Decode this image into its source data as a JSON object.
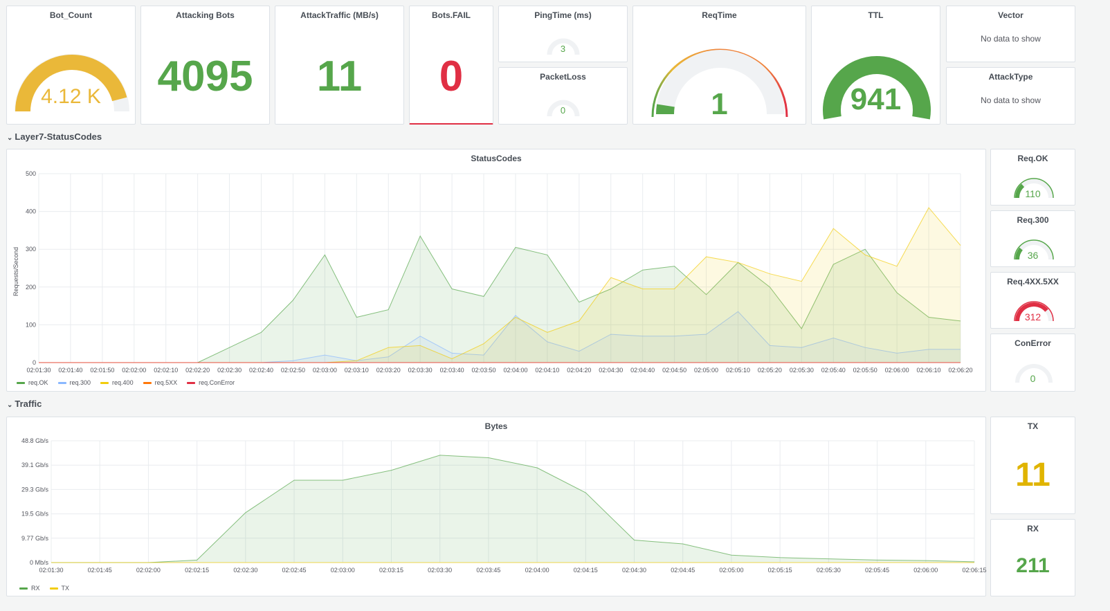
{
  "colors": {
    "green": "#56a64b",
    "yellow": "#f2cc0c",
    "red": "#e02f44",
    "orange": "#ff780a",
    "blue": "#8ab8ff",
    "gauge_bg": "#f0f2f4",
    "gold": "#e0b400"
  },
  "top": {
    "bot_count": {
      "title": "Bot_Count",
      "value": "4.12 K",
      "fraction": 0.92
    },
    "attacking_bots": {
      "title": "Attacking Bots",
      "value": "4095"
    },
    "attack_traffic": {
      "title": "AttackTraffic (MB/s)",
      "value": "11"
    },
    "bots_fail": {
      "title": "Bots.FAIL",
      "value": "0"
    },
    "ping_time": {
      "title": "PingTime (ms)",
      "value": "3"
    },
    "packet_loss": {
      "title": "PacketLoss",
      "value": "0"
    },
    "req_time": {
      "title": "ReqTime",
      "value": "1",
      "fraction": 0.05
    },
    "ttl": {
      "title": "TTL",
      "value": "941",
      "fraction": 1.0
    },
    "vector": {
      "title": "Vector",
      "empty": "No data to show"
    },
    "attack_type": {
      "title": "AttackType",
      "empty": "No data to show"
    }
  },
  "rows": {
    "layer7": "Layer7-StatusCodes",
    "traffic": "Traffic"
  },
  "side": {
    "req_ok": {
      "title": "Req.OK",
      "value": "110",
      "fraction": 0.27
    },
    "req_300": {
      "title": "Req.300",
      "value": "36",
      "fraction": 0.22
    },
    "req_4xx": {
      "title": "Req.4XX.5XX",
      "value": "312",
      "fraction": 0.78
    },
    "con_error": {
      "title": "ConError",
      "value": "0",
      "fraction": 0
    },
    "tx": {
      "title": "TX",
      "value": "11"
    },
    "rx": {
      "title": "RX",
      "value": "211"
    }
  },
  "chart_data": [
    {
      "type": "area",
      "title": "StatusCodes",
      "ylabel": "Requests/Second",
      "ylim": [
        0,
        500
      ],
      "yticks": [
        "0",
        "100",
        "200",
        "300",
        "400",
        "500"
      ],
      "x": [
        "02:01:30",
        "02:01:40",
        "02:01:50",
        "02:02:00",
        "02:02:10",
        "02:02:20",
        "02:02:30",
        "02:02:40",
        "02:02:50",
        "02:03:00",
        "02:03:10",
        "02:03:20",
        "02:03:30",
        "02:03:40",
        "02:03:50",
        "02:04:00",
        "02:04:10",
        "02:04:20",
        "02:04:30",
        "02:04:40",
        "02:04:50",
        "02:05:00",
        "02:05:10",
        "02:05:20",
        "02:05:30",
        "02:05:40",
        "02:05:50",
        "02:06:00",
        "02:06:10",
        "02:06:20"
      ],
      "series": [
        {
          "name": "req.OK",
          "color": "#56a64b",
          "values": [
            0,
            0,
            0,
            0,
            0,
            0,
            40,
            80,
            165,
            285,
            120,
            140,
            335,
            195,
            175,
            305,
            285,
            160,
            195,
            245,
            255,
            180,
            265,
            200,
            90,
            260,
            300,
            185,
            120,
            110
          ]
        },
        {
          "name": "req.300",
          "color": "#8ab8ff",
          "values": [
            0,
            0,
            0,
            0,
            0,
            0,
            0,
            0,
            5,
            20,
            5,
            15,
            70,
            25,
            20,
            125,
            55,
            30,
            75,
            70,
            70,
            75,
            135,
            45,
            40,
            65,
            40,
            25,
            35,
            35
          ]
        },
        {
          "name": "req.400",
          "color": "#f2cc0c",
          "values": [
            0,
            0,
            0,
            0,
            0,
            0,
            0,
            0,
            0,
            0,
            5,
            40,
            45,
            10,
            50,
            120,
            80,
            110,
            225,
            195,
            195,
            280,
            265,
            235,
            215,
            355,
            285,
            255,
            410,
            310
          ]
        },
        {
          "name": "req.5XX",
          "color": "#ff780a",
          "values": [
            0,
            0,
            0,
            0,
            0,
            0,
            0,
            0,
            0,
            0,
            0,
            0,
            0,
            0,
            0,
            0,
            0,
            0,
            0,
            0,
            0,
            0,
            0,
            0,
            0,
            0,
            0,
            0,
            0,
            0
          ]
        },
        {
          "name": "req.ConError",
          "color": "#e02f44",
          "values": [
            0,
            0,
            0,
            0,
            0,
            0,
            0,
            0,
            0,
            0,
            0,
            0,
            0,
            0,
            0,
            0,
            0,
            0,
            0,
            0,
            0,
            0,
            0,
            0,
            0,
            0,
            0,
            0,
            0,
            0
          ]
        }
      ]
    },
    {
      "type": "area",
      "title": "Bytes",
      "ylim": [
        0,
        48.8
      ],
      "yticks": [
        "0 Mb/s",
        "9.77 Gb/s",
        "19.5 Gb/s",
        "29.3 Gb/s",
        "39.1 Gb/s",
        "48.8 Gb/s"
      ],
      "x": [
        "02:01:30",
        "02:01:45",
        "02:02:00",
        "02:02:15",
        "02:02:30",
        "02:02:45",
        "02:03:00",
        "02:03:15",
        "02:03:30",
        "02:03:45",
        "02:04:00",
        "02:04:15",
        "02:04:30",
        "02:04:45",
        "02:05:00",
        "02:05:15",
        "02:05:30",
        "02:05:45",
        "02:06:00",
        "02:06:15"
      ],
      "series": [
        {
          "name": "RX",
          "color": "#56a64b",
          "values": [
            0,
            0,
            0,
            1,
            20,
            33,
            33,
            37,
            43,
            42,
            38,
            28,
            9,
            7.5,
            3,
            2,
            1.5,
            1,
            0.8,
            0.3
          ]
        },
        {
          "name": "TX",
          "color": "#f2cc0c",
          "values": [
            0,
            0,
            0,
            0,
            0,
            0,
            0,
            0,
            0,
            0,
            0,
            0,
            0,
            0,
            0,
            0,
            0,
            0,
            0,
            0
          ]
        }
      ]
    }
  ]
}
